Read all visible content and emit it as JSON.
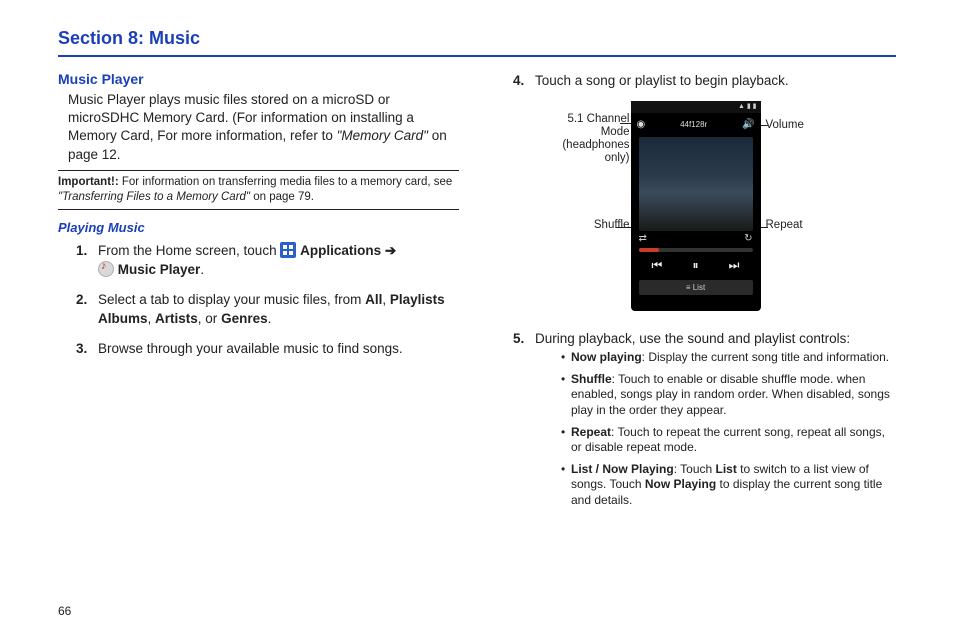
{
  "section_title": "Section 8: Music",
  "page_number": "66",
  "left": {
    "heading": "Music Player",
    "intro_pre": "Music Player plays music files stored on a microSD or microSDHC Memory Card. (For information on installing a Memory Card, For more information, refer to ",
    "intro_ref": "\"Memory Card\"",
    "intro_post": " on page 12.",
    "important_label": "Important!: ",
    "important_pre": "For information on transferring media files to a memory card, see ",
    "important_ref": "\"Transferring Files to a Memory Card\"",
    "important_post": " on page 79.",
    "playing_heading": "Playing Music",
    "step1_a": "From the Home screen, touch ",
    "step1_b": " Applications ",
    "step1_arrow": "➔",
    "step1_c": " Music Player",
    "step1_d": ".",
    "step2_a": "Select a tab to display your music files, from ",
    "step2_all": "All",
    "step2_comma1": ", ",
    "step2_playlists": "Playlists",
    "step2_space": " ",
    "step2_albums": "Albums",
    "step2_comma2": ", ",
    "step2_artists": "Artists",
    "step2_or": ", or ",
    "step2_genres": "Genres",
    "step2_end": ".",
    "step3": "Browse through your available music to find songs."
  },
  "right": {
    "step4": "Touch a song or playlist to begin playback.",
    "call_51": "5.1 Channel Mode (headphones only)",
    "call_shuffle": "Shuffle",
    "call_volume": "Volume",
    "call_repeat": "Repeat",
    "ph_track": "44f128r",
    "ph_list": "≡ List",
    "step5": "During playback, use the sound and playlist controls:",
    "b1_head": "Now playing",
    "b1_body": ": Display the current song title and information.",
    "b2_head": "Shuffle",
    "b2_body": ": Touch to enable or disable shuffle mode. when enabled, songs play in random order. When disabled, songs play in the order they appear.",
    "b3_head": "Repeat",
    "b3_body": ": Touch to repeat the current song, repeat all songs, or disable repeat mode.",
    "b4_head": "List / Now Playing",
    "b4_mid1": ": Touch ",
    "b4_list": "List",
    "b4_mid2": " to switch to a list view of songs. Touch ",
    "b4_np": "Now Playing",
    "b4_end": " to display the current song title and details."
  }
}
